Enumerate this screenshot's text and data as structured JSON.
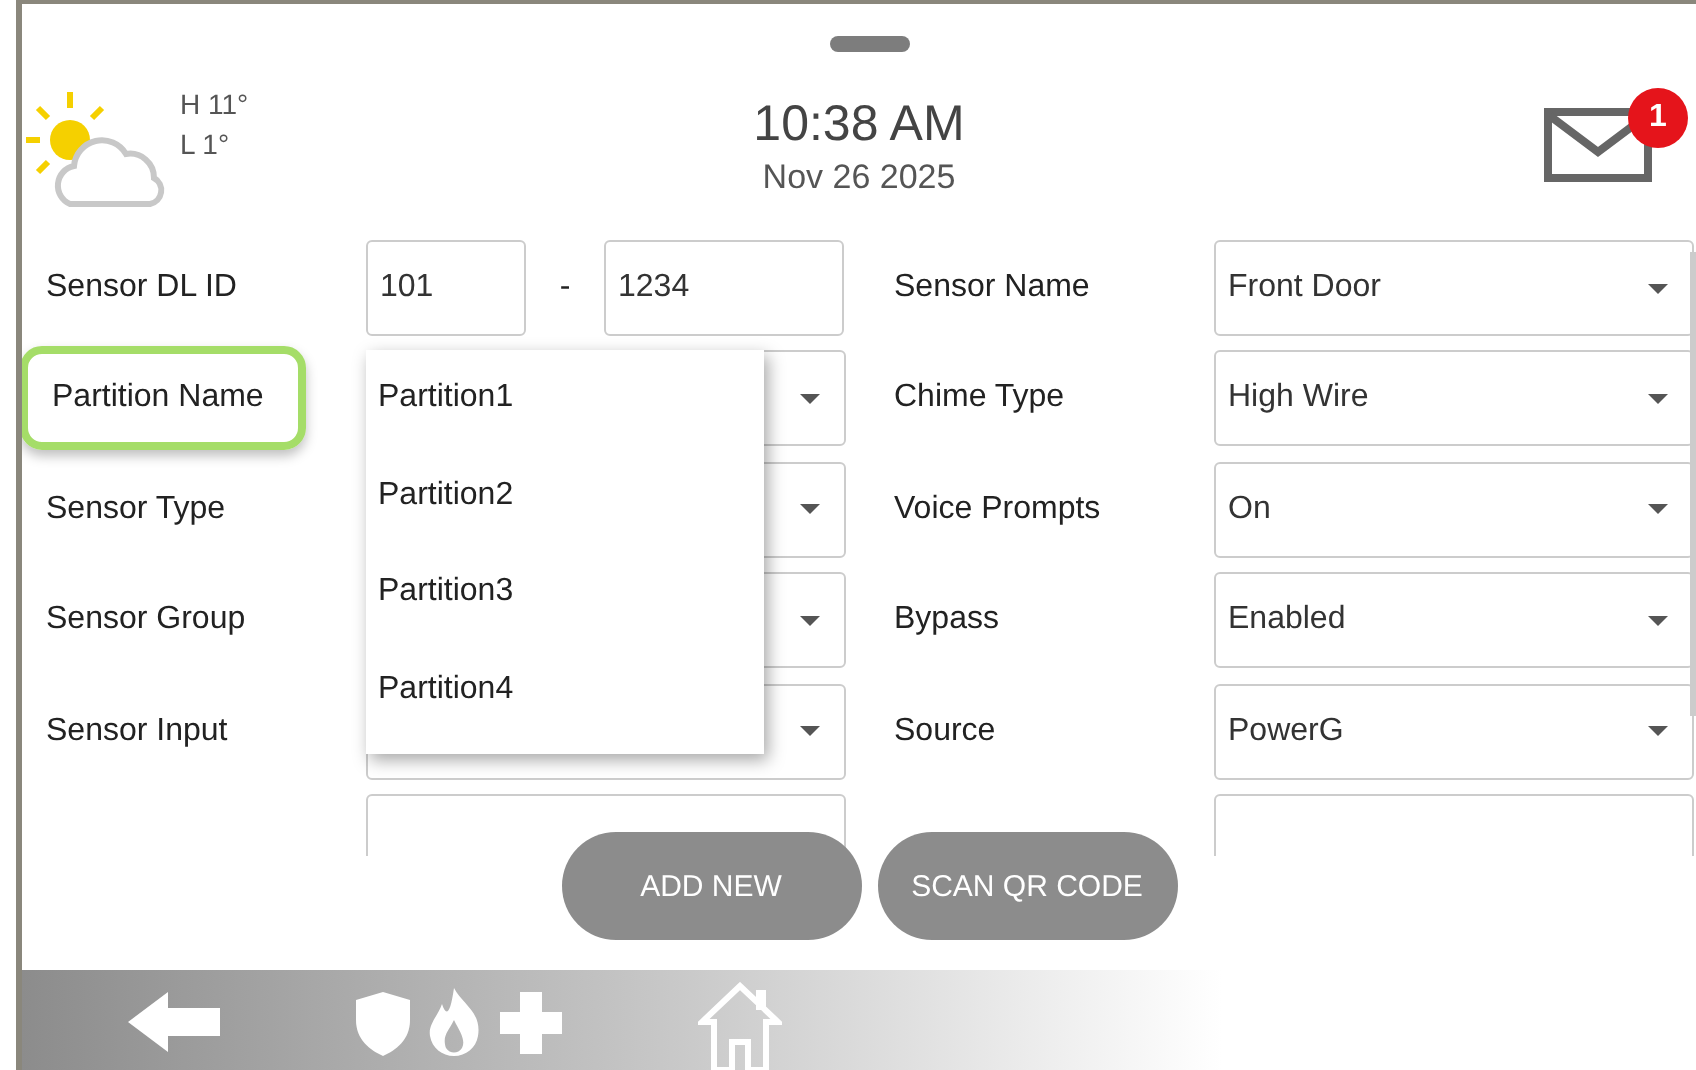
{
  "header": {
    "weather": {
      "high": "H 11°",
      "low": "L 1°"
    },
    "time": "10:38 AM",
    "date": "Nov 26 2025",
    "messages": {
      "badge": "1"
    }
  },
  "form": {
    "left": [
      {
        "kind": "id",
        "label": "Sensor DL ID",
        "values": [
          "101",
          "1234"
        ],
        "separator": "-",
        "highlighted": false
      },
      {
        "kind": "select",
        "label": "Partition Name",
        "highlighted": true,
        "expanded": true,
        "options": [
          "Partition1",
          "Partition2",
          "Partition3",
          "Partition4"
        ]
      },
      {
        "kind": "select",
        "label": "Sensor Type",
        "highlighted": false,
        "expanded": false
      },
      {
        "kind": "select",
        "label": "Sensor Group",
        "highlighted": false,
        "expanded": false
      },
      {
        "kind": "select",
        "label": "Sensor Input",
        "highlighted": false,
        "expanded": false
      }
    ],
    "right": [
      {
        "label": "Sensor Name",
        "value": "Front Door"
      },
      {
        "label": "Chime Type",
        "value": "High Wire"
      },
      {
        "label": "Voice Prompts",
        "value": "On"
      },
      {
        "label": "Bypass",
        "value": "Enabled"
      },
      {
        "label": "Source",
        "value": "PowerG"
      }
    ]
  },
  "buttons": [
    "ADD NEW",
    "SCAN QR CODE"
  ]
}
